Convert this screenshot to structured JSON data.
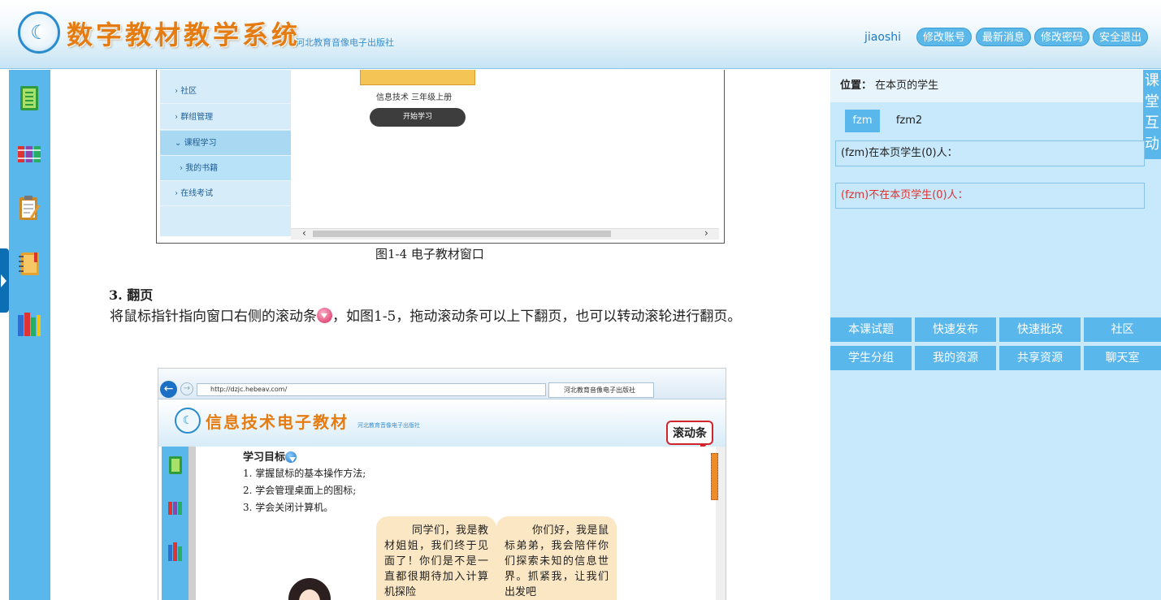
{
  "header": {
    "title": "数字教材教学系统",
    "subtitle": "河北教育音像电子出版社",
    "user": "jiaoshi",
    "buttons": [
      "修改账号",
      "最新消息",
      "修改密码",
      "安全退出"
    ]
  },
  "left_sidebar": {
    "icons": [
      "notes-icon",
      "bookshelf-icon",
      "clipboard-icon",
      "notebook-icon",
      "books-icon"
    ]
  },
  "content": {
    "figure1": {
      "nav_items": [
        "社区",
        "群组管理",
        "课程学习",
        "我的书籍",
        "在线考试"
      ],
      "book_name": "信息技术 三年级上册",
      "start_button": "开始学习",
      "caption": "图1-4 电子教材窗口"
    },
    "section_heading": "3. 翻页",
    "paragraph_before": "将鼠标指针指向窗口右侧的滚动条",
    "paragraph_after": "，如图1-5，拖动滚动条可以上下翻页，也可以转动滚轮进行翻页。",
    "figure2": {
      "url": "http://dzjc.hebeav.com/",
      "tab_title": "河北教育音像电子出版社",
      "title": "信息技术电子教材",
      "subtitle": "河北教育音像电子出版社",
      "callout": "滚动条",
      "goal_title": "学习目标",
      "goals": [
        "1. 掌握鼠标的基本操作方法;",
        "2. 学会管理桌面上的图标;",
        "3. 学会关闭计算机。"
      ],
      "bubble_left": "同学们，我是教材姐姐，我们终于见面了！你们是不是一直都很期待加入计算机探险",
      "bubble_right": "你们好，我是鼠标弟弟，我会陪伴你们探索未知的信息世界。抓紧我，让我们出发吧"
    }
  },
  "right_panel": {
    "location_label": "位置：",
    "location_value": "在本页的学生",
    "vertical_tab": [
      "课",
      "堂",
      "互",
      "动"
    ],
    "tabs": [
      "fzm",
      "fzm2"
    ],
    "present_text": "(fzm)在本页学生(0)人：",
    "absent_text": "(fzm)不在本页学生(0)人：",
    "grid_buttons": [
      "本课试题",
      "快速发布",
      "快速批改",
      "社区",
      "学生分组",
      "我的资源",
      "共享资源",
      "聊天室"
    ]
  },
  "colors": {
    "brand_blue": "#5ab7ec",
    "title_orange": "#e57c12",
    "absent_red": "#e0312f"
  }
}
